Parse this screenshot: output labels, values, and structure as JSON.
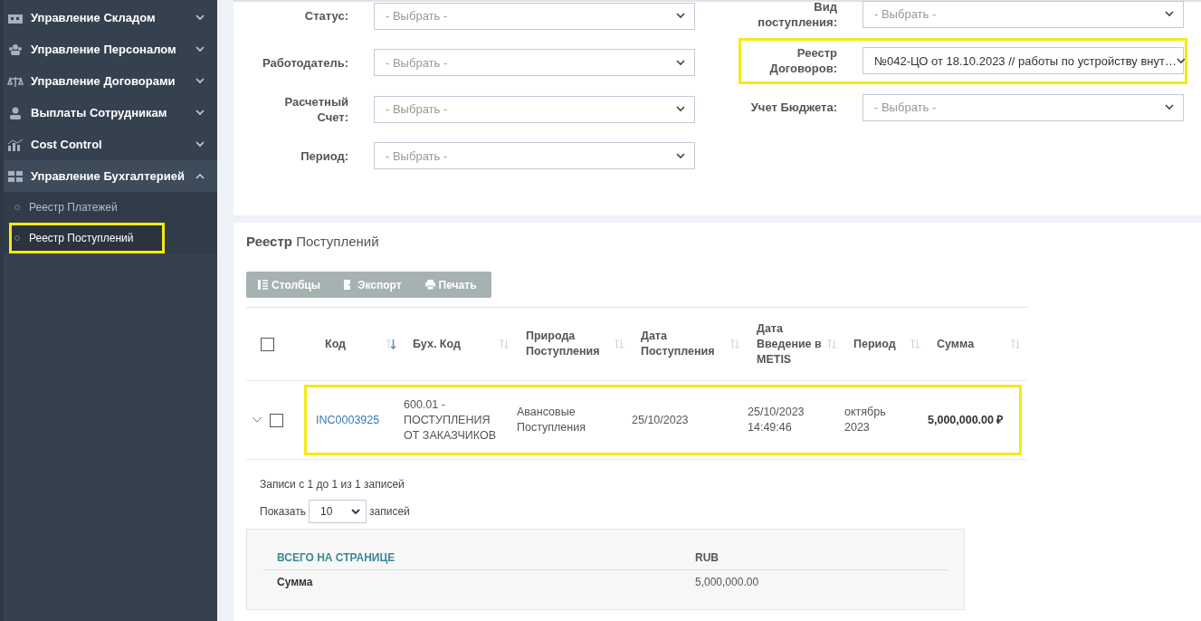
{
  "sidebar": {
    "items": [
      {
        "label": "Управление Складом",
        "expanded": false
      },
      {
        "label": "Управление Персоналом",
        "expanded": false
      },
      {
        "label": "Управление Договорами",
        "expanded": false
      },
      {
        "label": "Выплаты Сотрудникам",
        "expanded": false
      },
      {
        "label": "Cost Control",
        "expanded": false
      },
      {
        "label": "Управление Бухгалтерией",
        "expanded": true,
        "children": [
          {
            "label": "Реестр Платежей",
            "selected": false,
            "highlighted": false
          },
          {
            "label": "Реестр Поступлений",
            "selected": true,
            "highlighted": true
          }
        ]
      }
    ]
  },
  "filters": {
    "left": [
      {
        "label": "Статус:",
        "placeholder": "- Выбрать -",
        "highlighted": false
      },
      {
        "label": "Работодатель:",
        "placeholder": "- Выбрать -",
        "highlighted": false
      },
      {
        "label": "Расчетный Счет:",
        "placeholder": "- Выбрать -",
        "highlighted": false
      },
      {
        "label": "Период:",
        "placeholder": "- Выбрать -",
        "highlighted": false
      }
    ],
    "right": [
      {
        "label": "Вид поступления:",
        "placeholder": "- Выбрать -",
        "highlighted": false
      },
      {
        "label": "Реестр Договоров:",
        "value": "№042-ЦО от 18.10.2023 // работы по устройству внут…",
        "highlighted": true
      },
      {
        "label": "Учет Бюджета:",
        "placeholder": "- Выбрать -",
        "highlighted": false
      }
    ]
  },
  "table": {
    "title": "**Реестр** Поступлений",
    "toolbar": [
      "Столбцы",
      "Экспорт",
      "Печать"
    ],
    "select_all": {
      "checked": false
    },
    "columns": [
      {
        "label": "Код",
        "sorted": true
      },
      {
        "label": "Бух. Код",
        "sorted": false
      },
      {
        "label": "Природа Поступления",
        "sorted": false
      },
      {
        "label": "Дата Поступления",
        "sorted": false
      },
      {
        "label": "Дата Введение в METIS",
        "sorted": false
      },
      {
        "label": "Период",
        "sorted": false
      },
      {
        "label": "Сумма",
        "sorted": false
      }
    ],
    "rows": [
      {
        "expanded": false,
        "checked": false,
        "highlighted": true,
        "cells": [
          "INC0003925",
          "600.01 - ПОСТУПЛЕНИЯ ОТ ЗАКАЗЧИКОВ",
          "Авансовые Поступления",
          "25/10/2023",
          "25/10/2023 14:49:46",
          "октябрь 2023",
          "5,000,000.00 ₽"
        ]
      }
    ],
    "info": "Записи с 1 до 1 из 1 записей",
    "length": {
      "prefix": "Показать",
      "value": "10",
      "suffix": "записей"
    }
  },
  "summary": {
    "heading": "ВСЕГО НА СТРАНИЦЕ",
    "currency": "RUB",
    "rows": [
      {
        "label": "Сумма",
        "value": "5,000,000.00"
      }
    ]
  }
}
